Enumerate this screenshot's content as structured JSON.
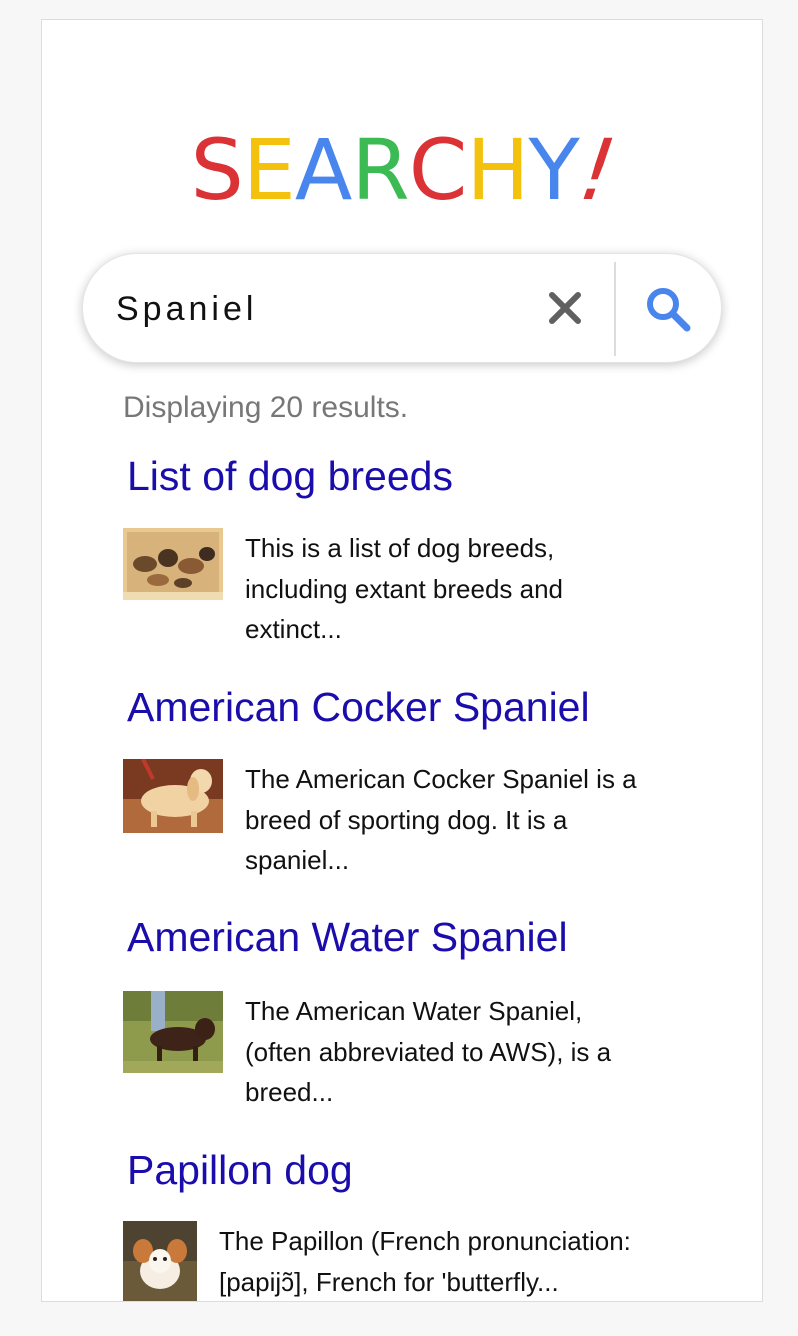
{
  "logo": {
    "letters": [
      {
        "char": "S",
        "color": "#DB3236"
      },
      {
        "char": "E",
        "color": "#F4C20D"
      },
      {
        "char": "A",
        "color": "#4885ED"
      },
      {
        "char": "R",
        "color": "#3CBA54"
      },
      {
        "char": "C",
        "color": "#DB3236"
      },
      {
        "char": "H",
        "color": "#F4C20D"
      },
      {
        "char": "Y",
        "color": "#4885ED"
      },
      {
        "char": "!",
        "color": "#DB3236"
      }
    ]
  },
  "search": {
    "value": "Spaniel",
    "clear_icon": "close-icon",
    "search_icon": "magnifier-icon",
    "icon_color_clear": "#606060",
    "icon_color_search": "#4885ED"
  },
  "result_count_text": "Displaying 20 results.",
  "results": [
    {
      "title": "List of dog breeds",
      "snippet_lines": [
        "This is a list of dog breeds,",
        "including extant breeds and",
        "extinct..."
      ],
      "thumbnail": "dog-breeds-illustration"
    },
    {
      "title": "American Cocker Spaniel",
      "snippet_lines": [
        "The American Cocker Spaniel is a",
        "breed of sporting dog. It is a",
        "spaniel..."
      ],
      "thumbnail": "cocker-spaniel-photo"
    },
    {
      "title": "American Water Spaniel",
      "snippet_lines": [
        "The American Water Spaniel,",
        "(often abbreviated to AWS), is a",
        "breed..."
      ],
      "thumbnail": "water-spaniel-photo"
    },
    {
      "title": "Papillon dog",
      "snippet_lines": [
        "The Papillon (French pronunciation:",
        "[papijɔ̃], French for 'butterfly..."
      ],
      "thumbnail": "papillon-photo"
    }
  ],
  "colors": {
    "link": "#1a0dab",
    "muted": "#777777",
    "text": "#111111"
  }
}
